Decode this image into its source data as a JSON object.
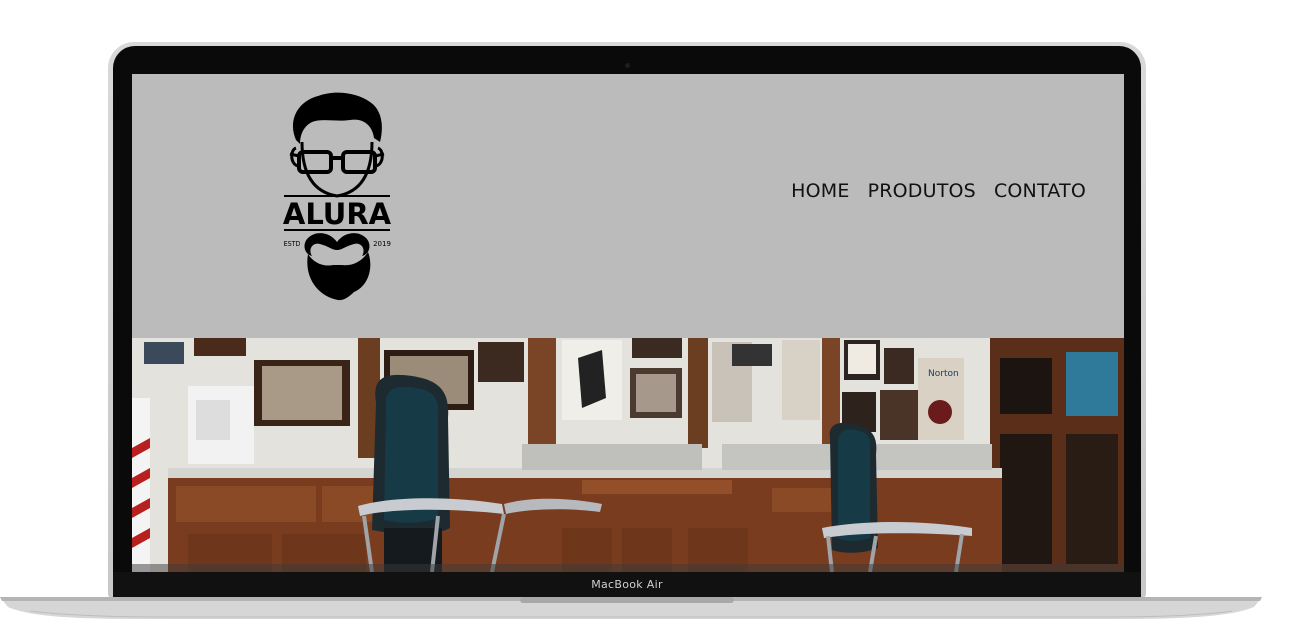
{
  "site": {
    "logo": {
      "name": "ALURA",
      "estd_label": "ESTD",
      "year": "2019"
    },
    "nav": {
      "items": [
        {
          "label": "HOME"
        },
        {
          "label": "PRODUTOS"
        },
        {
          "label": "CONTATO"
        }
      ]
    },
    "header_color": "#bbbbbb"
  },
  "device": {
    "label": "MacBook Air"
  }
}
